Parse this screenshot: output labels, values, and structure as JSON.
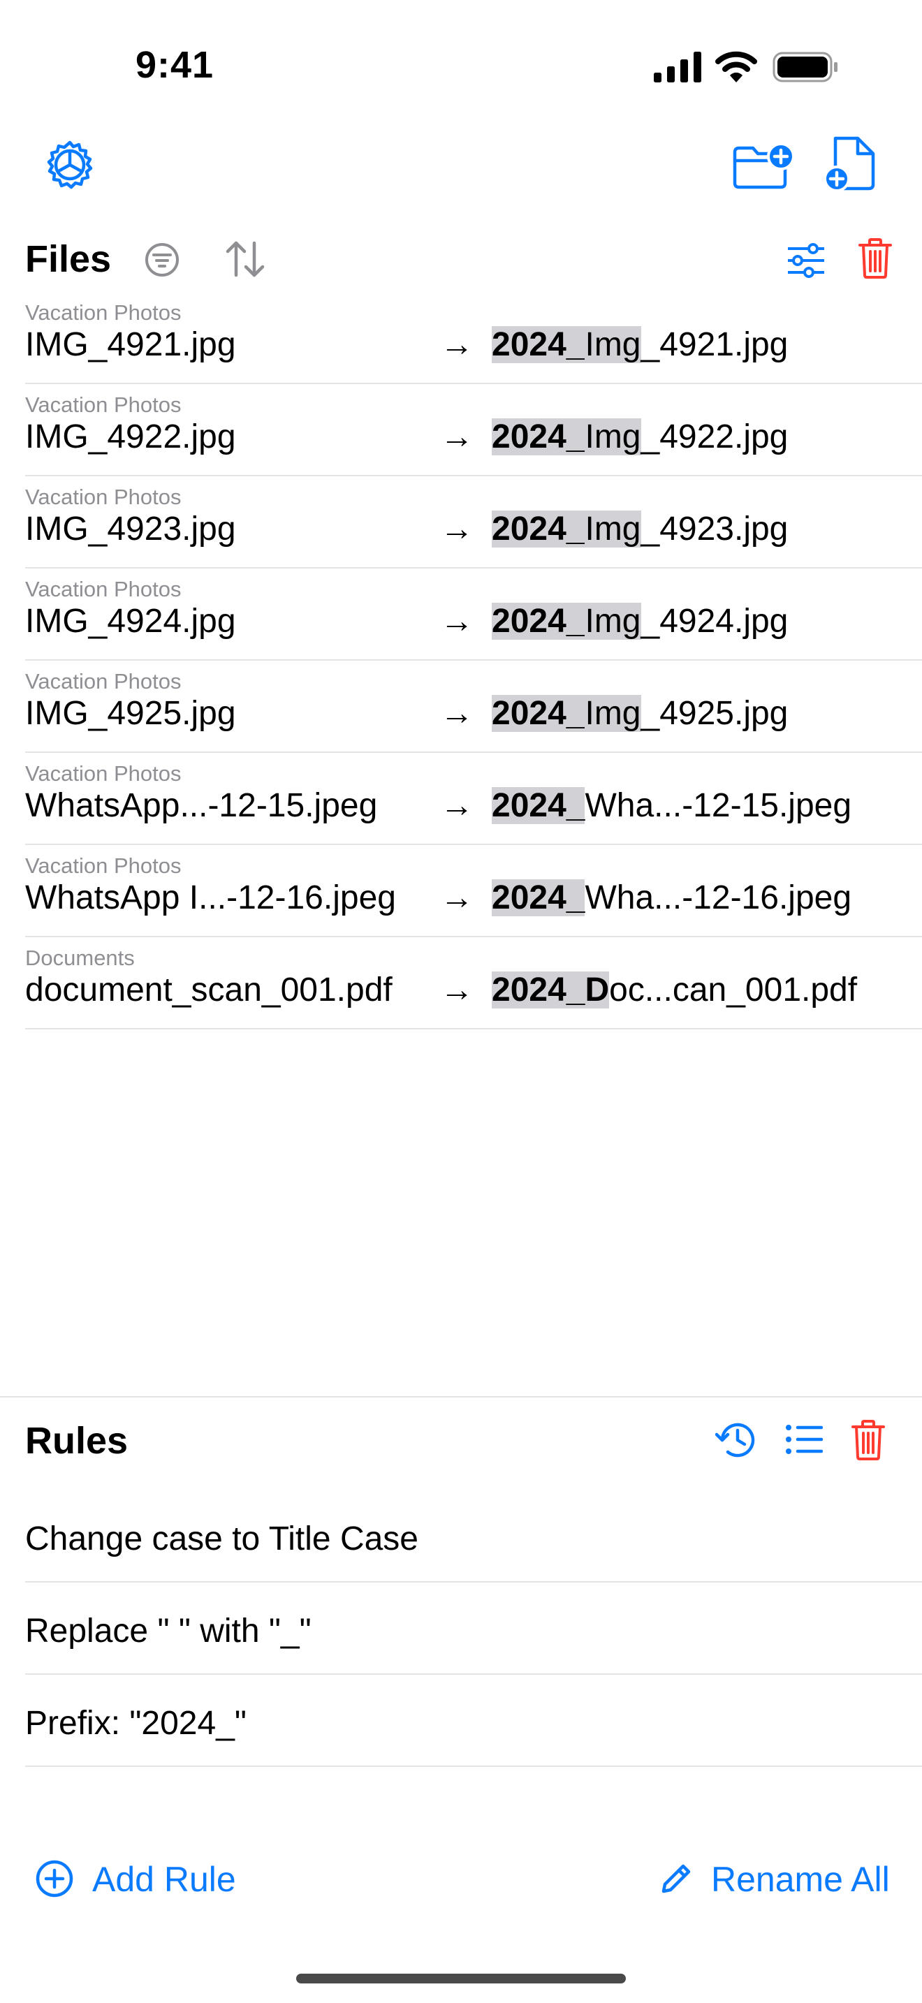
{
  "status_bar": {
    "time": "9:41"
  },
  "files_section": {
    "title": "Files",
    "rows": [
      {
        "folder": "Vacation Photos",
        "original": "IMG_4921.jpg",
        "arrow": "→",
        "new_hl1": "2024_",
        "new_hl2": "Img",
        "new_rest": "_4921.jpg"
      },
      {
        "folder": "Vacation Photos",
        "original": "IMG_4922.jpg",
        "arrow": "→",
        "new_hl1": "2024_",
        "new_hl2": "Img",
        "new_rest": "_4922.jpg"
      },
      {
        "folder": "Vacation Photos",
        "original": "IMG_4923.jpg",
        "arrow": "→",
        "new_hl1": "2024_",
        "new_hl2": "Img",
        "new_rest": "_4923.jpg"
      },
      {
        "folder": "Vacation Photos",
        "original": "IMG_4924.jpg",
        "arrow": "→",
        "new_hl1": "2024_",
        "new_hl2": "Img",
        "new_rest": "_4924.jpg"
      },
      {
        "folder": "Vacation Photos",
        "original": "IMG_4925.jpg",
        "arrow": "→",
        "new_hl1": "2024_",
        "new_hl2": "Img",
        "new_rest": "_4925.jpg"
      },
      {
        "folder": "Vacation Photos",
        "original": "WhatsApp...-12-15.jpeg",
        "arrow": "→",
        "new_hl1": "2024_",
        "new_hl2": "",
        "new_rest": "Wha...-12-15.jpeg"
      },
      {
        "folder": "Vacation Photos",
        "original": "WhatsApp I...-12-16.jpeg",
        "arrow": "→",
        "new_hl1": "2024_",
        "new_hl2": "",
        "new_rest": "Wha...-12-16.jpeg"
      },
      {
        "folder": "Documents",
        "original": "document_scan_001.pdf",
        "arrow": "→",
        "new_hl1": "2024_D",
        "new_hl2": "",
        "new_rest": "oc...can_001.pdf"
      }
    ]
  },
  "rules_section": {
    "title": "Rules",
    "rules": [
      "Change case to Title Case",
      "Replace \" \" with \"_\"",
      "Prefix: \"2024_\""
    ]
  },
  "bottom_bar": {
    "add_rule_label": "Add Rule",
    "rename_all_label": "Rename All"
  },
  "colors": {
    "accent": "#0a7bff",
    "destructive": "#ff3b30",
    "secondary_text": "#8e8e93",
    "highlight": "#d1d1d6"
  },
  "icons": {
    "settings": "gear-icon",
    "add_folder": "folder-add-icon",
    "add_file": "file-add-icon",
    "filter": "filter-icon",
    "sort": "sort-icon",
    "adjust": "sliders-icon",
    "delete": "trash-icon",
    "history": "history-icon",
    "list": "list-icon",
    "add": "plus-circle-icon",
    "edit": "pencil-icon"
  }
}
